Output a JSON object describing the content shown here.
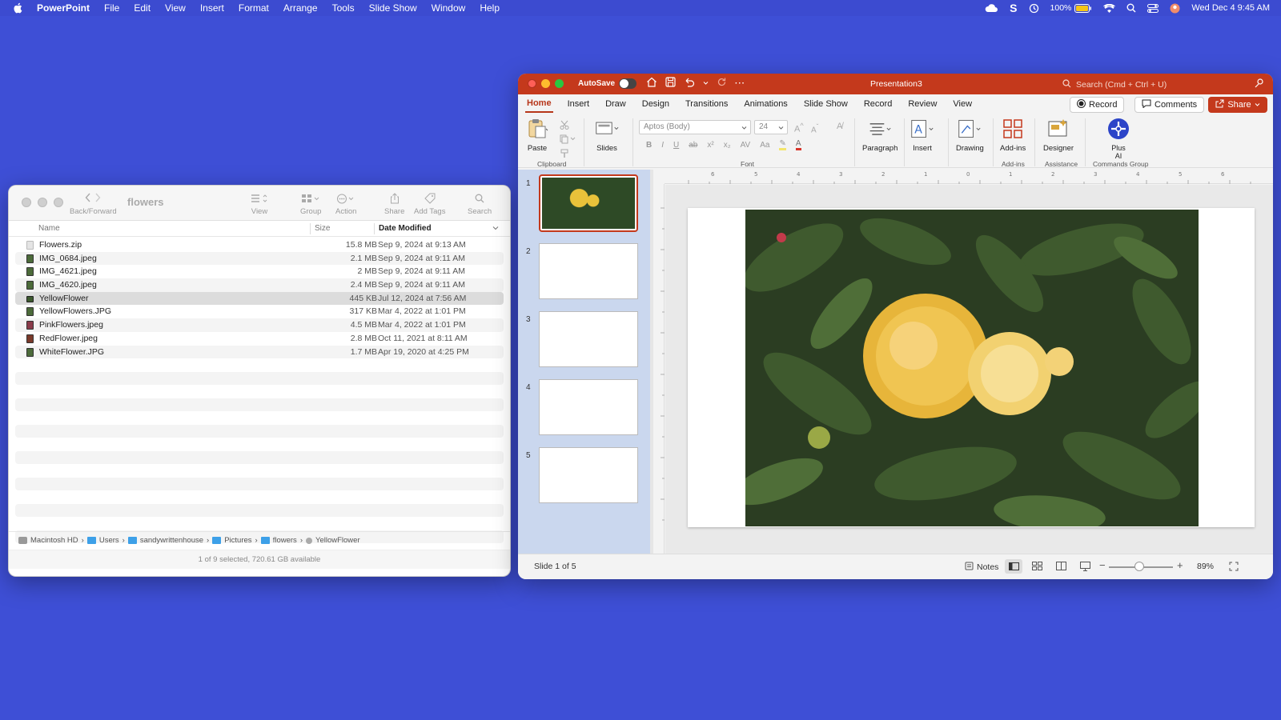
{
  "menubar": {
    "app": "PowerPoint",
    "items": [
      "File",
      "Edit",
      "View",
      "Insert",
      "Format",
      "Arrange",
      "Tools",
      "Slide Show",
      "Window",
      "Help"
    ],
    "battery": "100%",
    "datetime": "Wed Dec 4  9:45 AM"
  },
  "finder": {
    "title": "flowers",
    "toolbar": {
      "nav_label": "Back/Forward",
      "view_label": "View",
      "group_label": "Group",
      "action_label": "Action",
      "share_label": "Share",
      "tags_label": "Add Tags",
      "search_label": "Search"
    },
    "columns": {
      "name": "Name",
      "size": "Size",
      "date": "Date Modified"
    },
    "files": [
      {
        "name": "Flowers.zip",
        "size": "15.8 MB",
        "date": "Sep 9, 2024 at 9:13 AM",
        "icon_color": "#d8d8d8"
      },
      {
        "name": "IMG_0684.jpeg",
        "size": "2.1 MB",
        "date": "Sep 9, 2024 at 9:11 AM",
        "icon_color": "#4c6b3a"
      },
      {
        "name": "IMG_4621.jpeg",
        "size": "2 MB",
        "date": "Sep 9, 2024 at 9:11 AM",
        "icon_color": "#4c6b3a"
      },
      {
        "name": "IMG_4620.jpeg",
        "size": "2.4 MB",
        "date": "Sep 9, 2024 at 9:11 AM",
        "icon_color": "#4c6b3a"
      },
      {
        "name": "YellowFlower",
        "size": "445 KB",
        "date": "Jul 12, 2024 at 7:56 AM",
        "icon_color": "#3d5a2f"
      },
      {
        "name": "YellowFlowers.JPG",
        "size": "317 KB",
        "date": "Mar 4, 2022 at 1:01 PM",
        "icon_color": "#4c6b3a"
      },
      {
        "name": "PinkFlowers.jpeg",
        "size": "4.5 MB",
        "date": "Mar 4, 2022 at 1:01 PM",
        "icon_color": "#8a3b4a"
      },
      {
        "name": "RedFlower.jpeg",
        "size": "2.8 MB",
        "date": "Oct 11, 2021 at 8:11 AM",
        "icon_color": "#7a3a2a"
      },
      {
        "name": "WhiteFlower.JPG",
        "size": "1.7 MB",
        "date": "Apr 19, 2020 at 4:25 PM",
        "icon_color": "#4c6b3a"
      }
    ],
    "path": [
      "Macintosh HD",
      "Users",
      "sandywrittenhouse",
      "Pictures",
      "flowers",
      "YellowFlower"
    ],
    "status": "1 of 9 selected, 720.61 GB available"
  },
  "ppt": {
    "autosave": "AutoSave",
    "title": "Presentation3",
    "search": "Search (Cmd + Ctrl + U)",
    "tabs": [
      "Home",
      "Insert",
      "Draw",
      "Design",
      "Transitions",
      "Animations",
      "Slide Show",
      "Record",
      "Review",
      "View"
    ],
    "record": "Record",
    "comments": "Comments",
    "share": "Share",
    "ribbon": {
      "paste": "Paste",
      "slides": "Slides",
      "font_name": "Aptos (Body)",
      "font_size": "24",
      "paragraph": "Paragraph",
      "insert": "Insert",
      "drawing": "Drawing",
      "addins": "Add-ins",
      "designer": "Designer",
      "plus_ai": "Plus\nAI",
      "groups": {
        "clipboard": "Clipboard",
        "font": "Font",
        "addins": "Add-ins",
        "assistance": "Assistance",
        "commands": "Commands Group"
      }
    },
    "slides": [
      "1",
      "2",
      "3",
      "4",
      "5"
    ],
    "status": {
      "slide": "Slide 1 of 5",
      "notes": "Notes",
      "zoom": "89%"
    }
  }
}
